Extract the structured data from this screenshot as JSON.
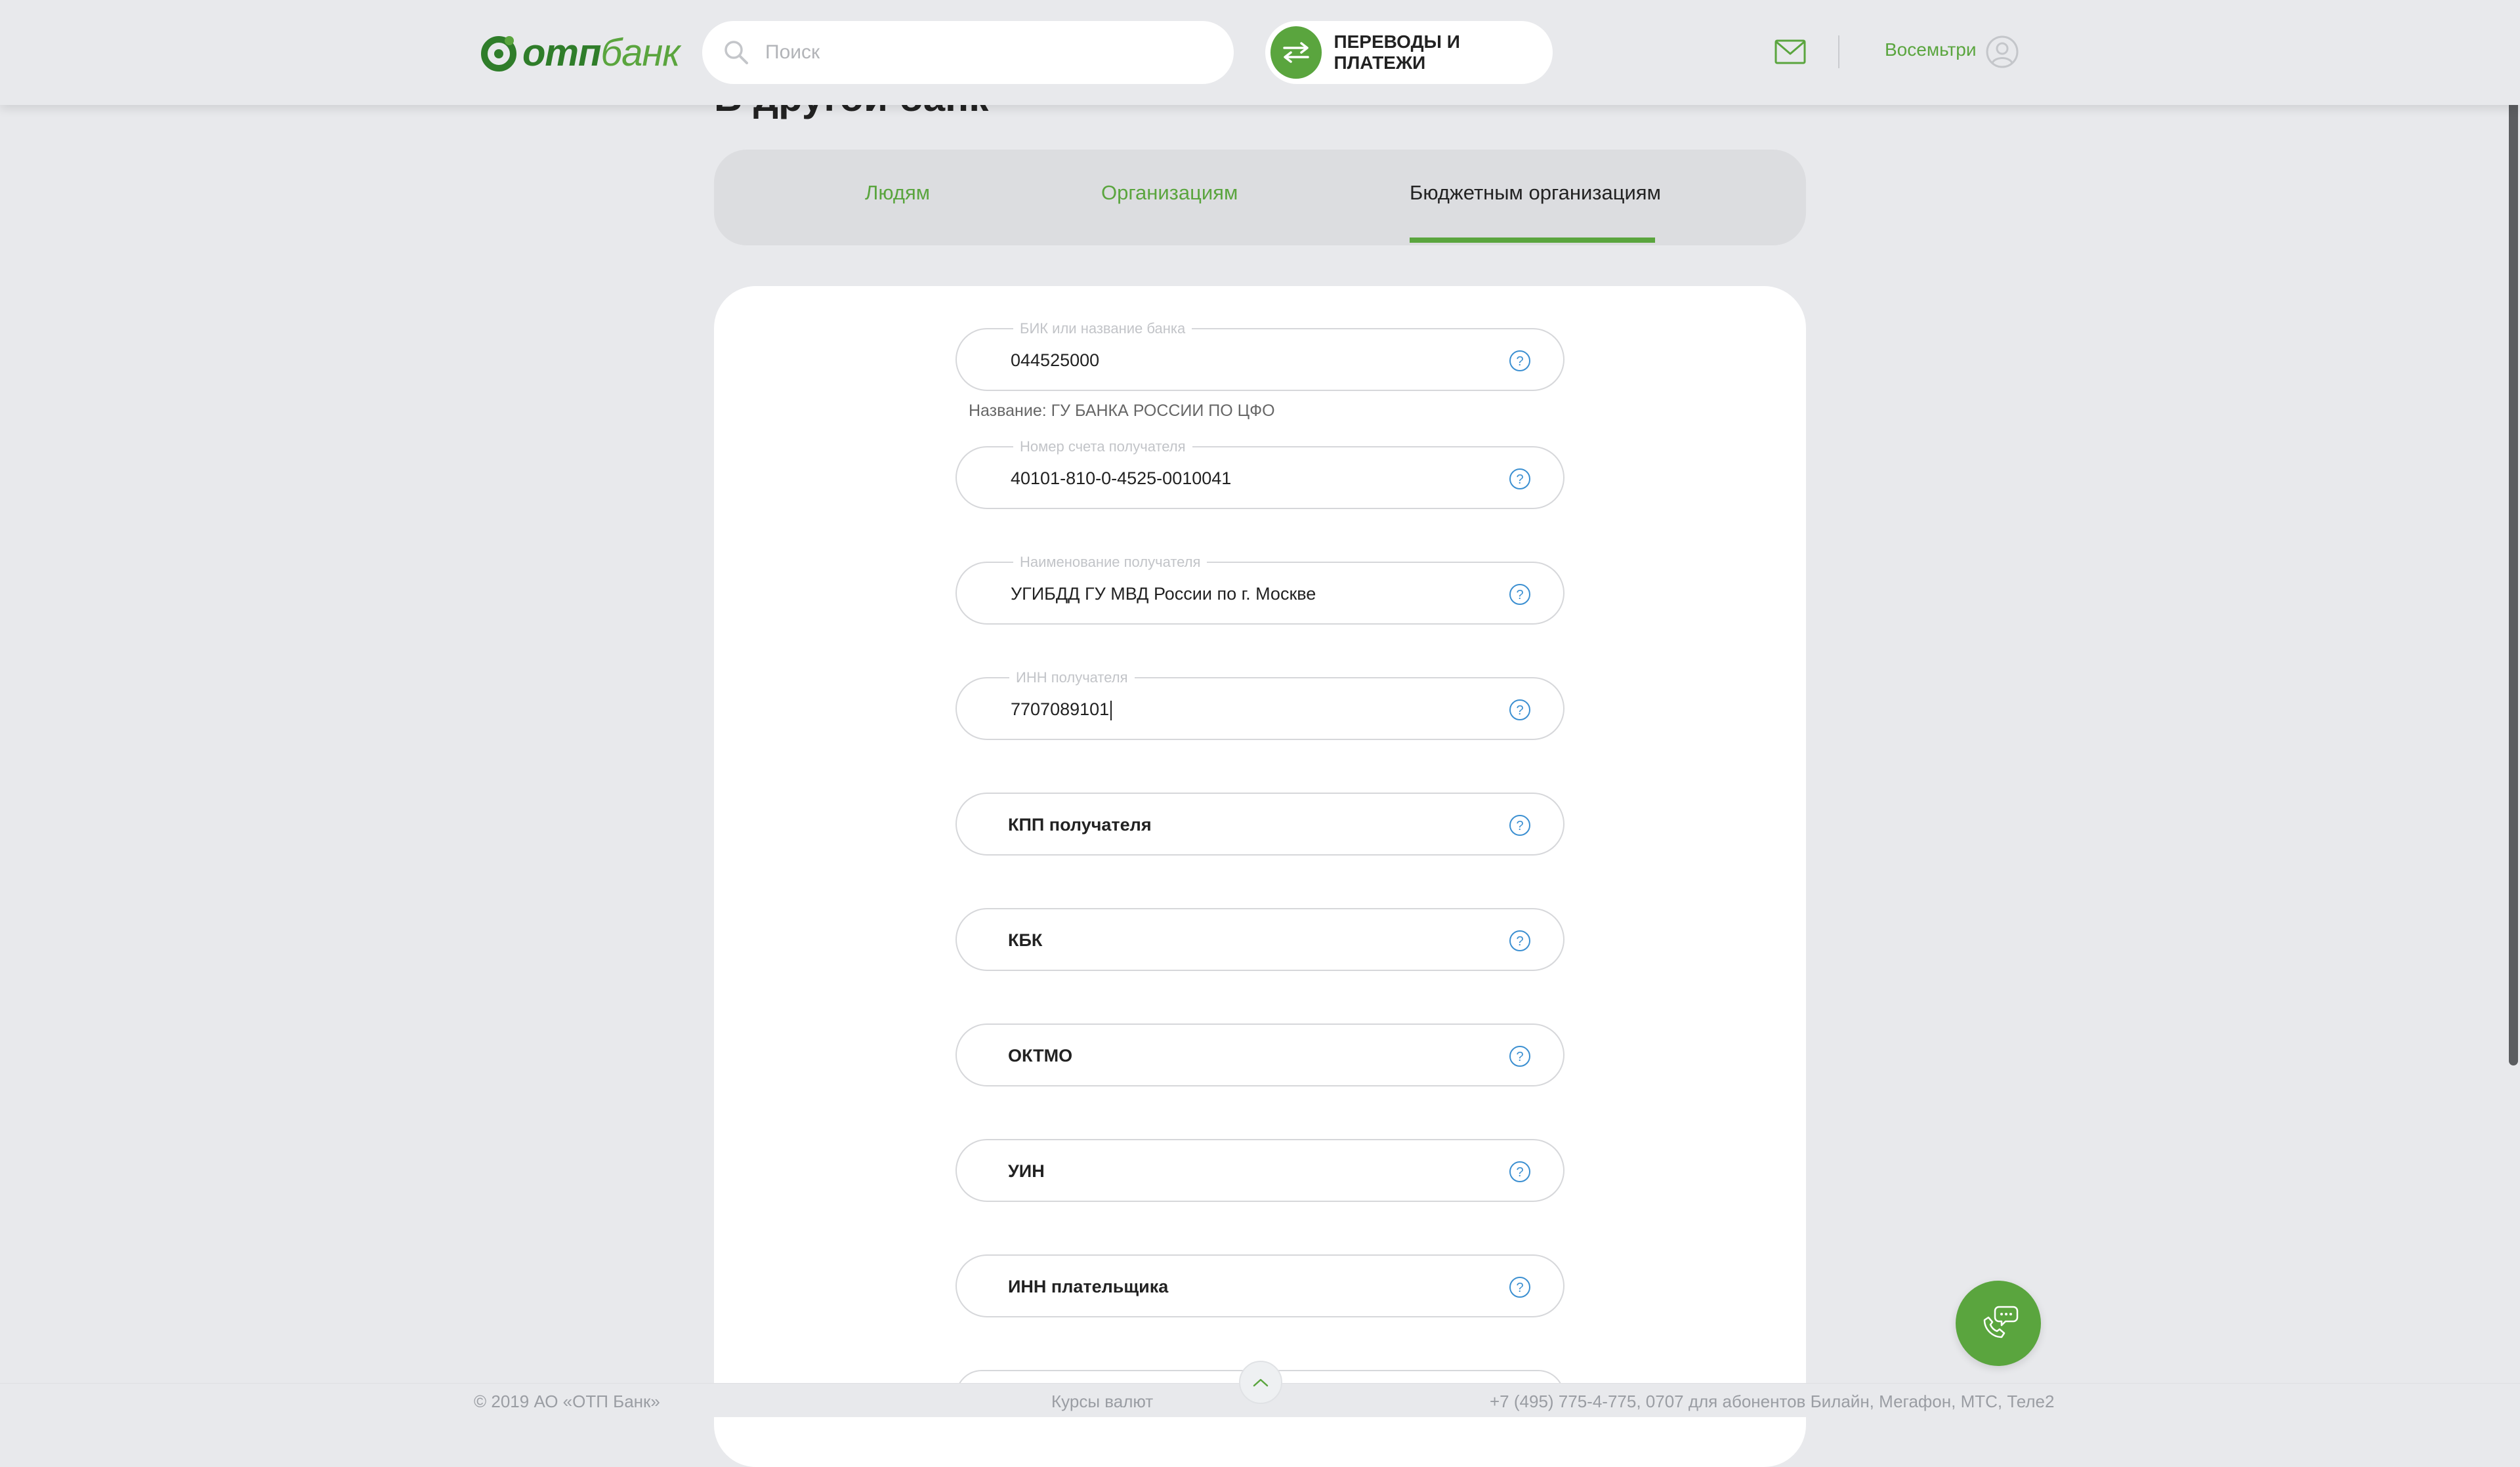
{
  "header": {
    "logo_text_a": "отп",
    "logo_text_b": "банк",
    "search_placeholder": "Поиск",
    "transfers_label": "ПЕРЕВОДЫ И ПЛАТЕЖИ",
    "user_name": "Восемьтри"
  },
  "page": {
    "heading": "В другой банк"
  },
  "tabs": [
    {
      "label": "Людям",
      "active": false
    },
    {
      "label": "Организациям",
      "active": false
    },
    {
      "label": "Бюджетным организациям",
      "active": true
    }
  ],
  "form": {
    "bik": {
      "legend": "БИК или название банка",
      "value": "044525000"
    },
    "bank_name": "Название: ГУ БАНКА РОССИИ ПО ЦФО",
    "account": {
      "legend": "Номер счета получателя",
      "value": "40101-810-0-4525-0010041"
    },
    "recipient": {
      "legend": "Наименование получателя",
      "value": "УГИБДД ГУ МВД России по г. Москве"
    },
    "inn": {
      "legend": "ИНН получателя",
      "value": "7707089101"
    },
    "kpp": {
      "placeholder": "КПП получателя"
    },
    "kbk": {
      "placeholder": "КБК"
    },
    "oktmo": {
      "placeholder": "ОКТМО"
    },
    "uin": {
      "placeholder": "УИН"
    },
    "payer_inn": {
      "placeholder": "ИНН плательщика"
    }
  },
  "footer": {
    "copyright": "© 2019 АО «ОТП Банк»",
    "rates": "Курсы валют",
    "phones": "+7 (495) 775-4-775,  0707 для абонентов Билайн, Мегафон, МТС, Теле2"
  },
  "colors": {
    "brand_green": "#5aa53e",
    "brand_dark_green": "#2f7d2a",
    "help_blue": "#3b8fd1"
  }
}
